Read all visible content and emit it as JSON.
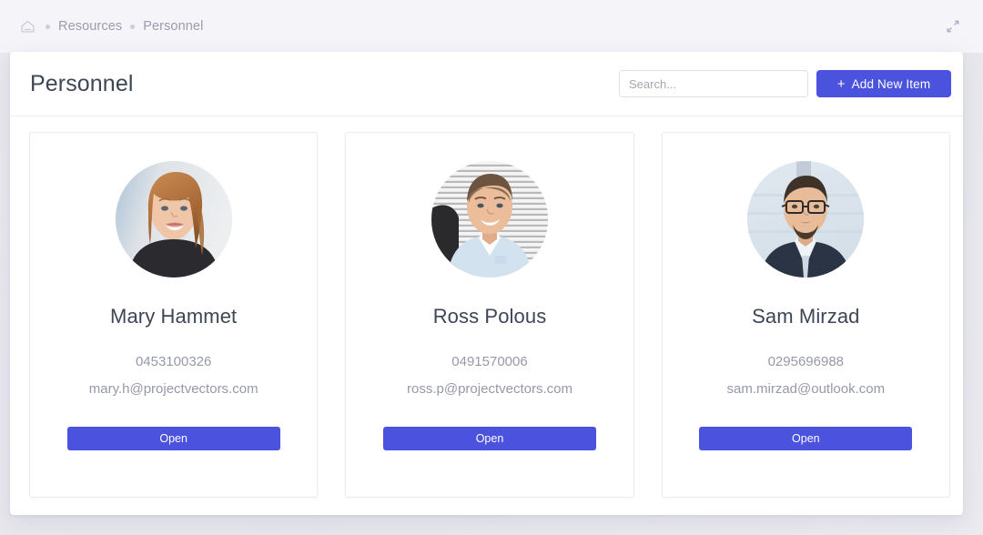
{
  "topbar": {
    "home_icon": "home-icon",
    "expand_icon": "expand-icon",
    "breadcrumb": [
      {
        "label": "Resources"
      },
      {
        "label": "Personnel"
      }
    ]
  },
  "header": {
    "title": "Personnel",
    "search_placeholder": "Search...",
    "search_value": "",
    "add_button_plus": "+",
    "add_button_label": "Add New Item"
  },
  "colors": {
    "accent": "#4b52dd",
    "page_background": "#e9e9ee",
    "topbar_background": "#f5f5f9",
    "panel_background": "#ffffff",
    "title_text": "#3d4656",
    "muted_text": "#9599a9",
    "breadcrumb_text": "#9a9bb0",
    "card_border": "#ebebef"
  },
  "cards": [
    {
      "name": "Mary Hammet",
      "phone": "0453100326",
      "email": "mary.h@projectvectors.com",
      "open_label": "Open",
      "avatar": "avatar-photo-woman"
    },
    {
      "name": "Ross Polous",
      "phone": "0491570006",
      "email": "ross.p@projectvectors.com",
      "open_label": "Open",
      "avatar": "avatar-photo-man-blinds"
    },
    {
      "name": "Sam Mirzad",
      "phone": "0295696988",
      "email": "sam.mirzad@outlook.com",
      "open_label": "Open",
      "avatar": "avatar-photo-man-glasses"
    }
  ]
}
